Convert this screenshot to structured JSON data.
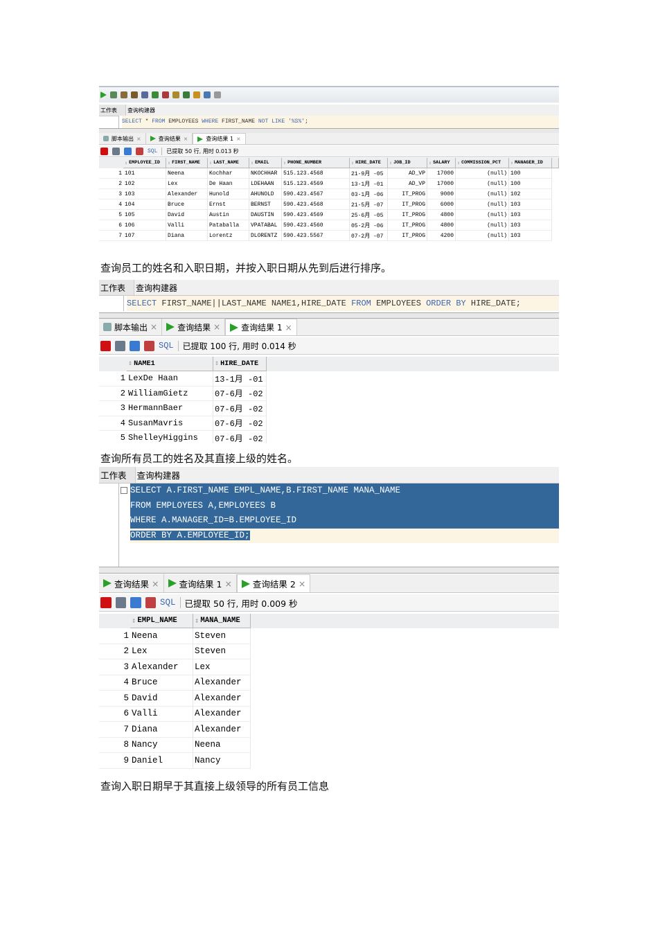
{
  "captions": [
    "查询员工的姓名和入职日期，并按入职日期从先到后进行排序。",
    "查询所有员工的姓名及其直接上级的姓名。",
    "查询入职日期早于其直接上级领导的所有员工信息"
  ],
  "shots": [
    {
      "worksheet_tabs": [
        "工作表",
        "查询构建器"
      ],
      "sql": [
        [
          [
            "SELECT",
            "kw"
          ],
          [
            " * ",
            ""
          ],
          [
            "FROM",
            "kw"
          ],
          [
            " EMPLOYEES ",
            ""
          ],
          [
            "WHERE",
            "kw"
          ],
          [
            " FIRST_NAME ",
            ""
          ],
          [
            "NOT LIKE",
            "kw"
          ],
          [
            " ",
            ""
          ],
          [
            "'%S%'",
            "str"
          ],
          [
            ";",
            ""
          ]
        ]
      ],
      "result_tabs": [
        {
          "label": "脚本输出",
          "icon": "script"
        },
        {
          "label": "查询结果",
          "icon": "run"
        },
        {
          "label": "查询结果 1",
          "icon": "run",
          "active": true
        }
      ],
      "sql_label": "SQL",
      "status": "已提取 50 行, 用时 0.013 秒",
      "columns": [
        "EMPLOYEE_ID",
        "FIRST_NAME",
        "LAST_NAME",
        "EMAIL",
        "PHONE_NUMBER",
        "HIRE_DATE",
        "JOB_ID",
        "SALARY",
        "COMMISSION_PCT",
        "MANAGER_ID"
      ],
      "rows": [
        [
          "101",
          "Neena",
          "Kochhar",
          "NKOCHHAR",
          "515.123.4568",
          "21-9月 -05",
          "AD_VP",
          "17000",
          "(null)",
          "100"
        ],
        [
          "102",
          "Lex",
          "De Haan",
          "LDEHAAN",
          "515.123.4569",
          "13-1月 -01",
          "AD_VP",
          "17000",
          "(null)",
          "100"
        ],
        [
          "103",
          "Alexander",
          "Hunold",
          "AHUNOLD",
          "590.423.4567",
          "03-1月 -06",
          "IT_PROG",
          "9000",
          "(null)",
          "102"
        ],
        [
          "104",
          "Bruce",
          "Ernst",
          "BERNST",
          "590.423.4568",
          "21-5月 -07",
          "IT_PROG",
          "6000",
          "(null)",
          "103"
        ],
        [
          "105",
          "David",
          "Austin",
          "DAUSTIN",
          "590.423.4569",
          "25-6月 -05",
          "IT_PROG",
          "4800",
          "(null)",
          "103"
        ],
        [
          "106",
          "Valli",
          "Pataballa",
          "VPATABAL",
          "590.423.4560",
          "05-2月 -06",
          "IT_PROG",
          "4800",
          "(null)",
          "103"
        ],
        [
          "107",
          "Diana",
          "Lorentz",
          "DLORENTZ",
          "590.423.5567",
          "07-2月 -07",
          "IT_PROG",
          "4200",
          "(null)",
          "103"
        ]
      ]
    },
    {
      "worksheet_tabs": [
        "工作表",
        "查询构建器"
      ],
      "sql": [
        [
          [
            "SELECT",
            "kw"
          ],
          [
            " FIRST_NAME||LAST_NAME NAME1,HIRE_DATE ",
            ""
          ],
          [
            "FROM",
            "kw"
          ],
          [
            " EMPLOYEES ",
            ""
          ],
          [
            "ORDER BY",
            "kw"
          ],
          [
            " HIRE_DATE;",
            ""
          ]
        ]
      ],
      "result_tabs": [
        {
          "label": "脚本输出",
          "icon": "script"
        },
        {
          "label": "查询结果",
          "icon": "run"
        },
        {
          "label": "查询结果 1",
          "icon": "run",
          "active": true
        }
      ],
      "sql_label": "SQL",
      "status": "已提取 100 行, 用时 0.014 秒",
      "columns": [
        "NAME1",
        "HIRE_DATE"
      ],
      "rows": [
        [
          "LexDe Haan",
          "13-1月 -01"
        ],
        [
          "WilliamGietz",
          "07-6月 -02"
        ],
        [
          "HermannBaer",
          "07-6月 -02"
        ],
        [
          "SusanMavris",
          "07-6月 -02"
        ],
        [
          "ShelleyHiggins",
          "07-6月 -02"
        ]
      ]
    },
    {
      "worksheet_tabs": [
        "工作表",
        "查询构建器"
      ],
      "sql": [
        [
          [
            "SELECT A.FIRST_NAME EMPL_NAME,B.FIRST_NAME MANA_NAME",
            "sel"
          ]
        ],
        [
          [
            "FROM EMPLOYEES A,EMPLOYEES B",
            "sel"
          ]
        ],
        [
          [
            "WHERE A.MANAGER_ID=B.EMPLOYEE_ID",
            "sel"
          ]
        ],
        [
          [
            "ORDER BY A.EMPLOYEE_ID;",
            "sel"
          ]
        ]
      ],
      "result_tabs": [
        {
          "label": "查询结果",
          "icon": "run"
        },
        {
          "label": "查询结果 1",
          "icon": "run"
        },
        {
          "label": "查询结果 2",
          "icon": "run",
          "active": true
        }
      ],
      "sql_label": "SQL",
      "status": "已提取 50 行, 用时 0.009 秒",
      "columns": [
        "EMPL_NAME",
        "MANA_NAME"
      ],
      "rows": [
        [
          "Neena",
          "Steven"
        ],
        [
          "Lex",
          "Steven"
        ],
        [
          "Alexander",
          "Lex"
        ],
        [
          "Bruce",
          "Alexander"
        ],
        [
          "David",
          "Alexander"
        ],
        [
          "Valli",
          "Alexander"
        ],
        [
          "Diana",
          "Alexander"
        ],
        [
          "Nancy",
          "Neena"
        ],
        [
          "Daniel",
          "Nancy"
        ]
      ]
    }
  ]
}
